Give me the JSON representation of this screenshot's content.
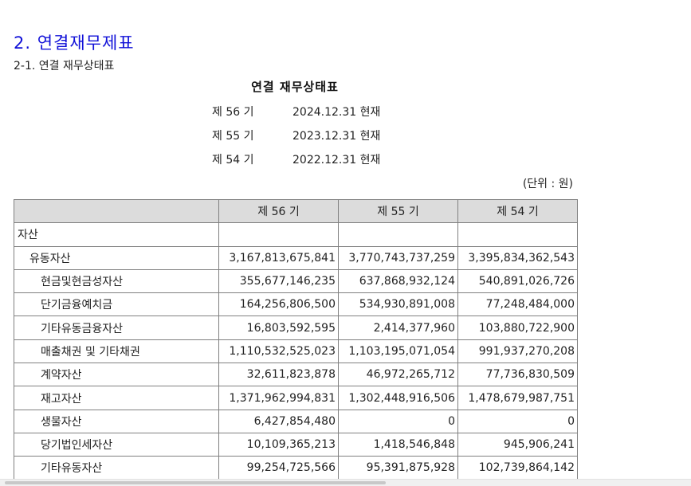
{
  "section_title": "2. 연결재무제표",
  "subsection_title": "2-1. 연결 재무상태표",
  "report_title": "연결 재무상태표",
  "periods": [
    {
      "label": "제 56 기",
      "date": "2024.12.31 현재"
    },
    {
      "label": "제 55 기",
      "date": "2023.12.31 현재"
    },
    {
      "label": "제 54 기",
      "date": "2022.12.31 현재"
    }
  ],
  "unit_note": "(단위 : 원)",
  "table": {
    "headers": [
      "",
      "제 56 기",
      "제 55 기",
      "제 54 기"
    ],
    "rows": [
      {
        "label": "자산",
        "level": 0,
        "values": [
          "",
          "",
          ""
        ]
      },
      {
        "label": "유동자산",
        "level": 1,
        "values": [
          "3,167,813,675,841",
          "3,770,743,737,259",
          "3,395,834,362,543"
        ]
      },
      {
        "label": "현금및현금성자산",
        "level": 2,
        "values": [
          "355,677,146,235",
          "637,868,932,124",
          "540,891,026,726"
        ]
      },
      {
        "label": "단기금융예치금",
        "level": 2,
        "values": [
          "164,256,806,500",
          "534,930,891,008",
          "77,248,484,000"
        ]
      },
      {
        "label": "기타유동금융자산",
        "level": 2,
        "values": [
          "16,803,592,595",
          "2,414,377,960",
          "103,880,722,900"
        ]
      },
      {
        "label": "매출채권 및 기타채권",
        "level": 2,
        "values": [
          "1,110,532,525,023",
          "1,103,195,071,054",
          "991,937,270,208"
        ]
      },
      {
        "label": "계약자산",
        "level": 2,
        "values": [
          "32,611,823,878",
          "46,972,265,712",
          "77,736,830,509"
        ]
      },
      {
        "label": "재고자산",
        "level": 2,
        "values": [
          "1,371,962,994,831",
          "1,302,448,916,506",
          "1,478,679,987,751"
        ]
      },
      {
        "label": "생물자산",
        "level": 2,
        "values": [
          "6,427,854,480",
          "0",
          "0"
        ]
      },
      {
        "label": "당기법인세자산",
        "level": 2,
        "values": [
          "10,109,365,213",
          "1,418,546,848",
          "945,906,241"
        ]
      },
      {
        "label": "기타유동자산",
        "level": 2,
        "values": [
          "99,254,725,566",
          "95,391,875,928",
          "102,739,864,142"
        ]
      }
    ]
  }
}
